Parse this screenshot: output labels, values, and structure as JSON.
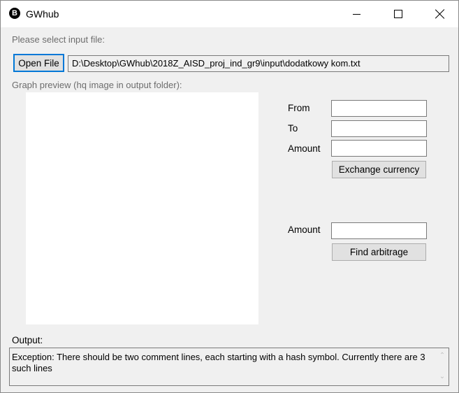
{
  "window": {
    "title": "GWhub",
    "app_icon_glyph": "B"
  },
  "input_section": {
    "prompt": "Please select input file:",
    "open_button_label": "Open File",
    "file_path": "D:\\Desktop\\GWhub\\2018Z_AISD_proj_ind_gr9\\input\\dodatkowy kom.txt"
  },
  "preview": {
    "label": "Graph preview (hq image in output folder):"
  },
  "exchange": {
    "from_label": "From",
    "to_label": "To",
    "amount_label": "Amount",
    "from_value": "",
    "to_value": "",
    "amount_value": "",
    "button_label": "Exchange currency"
  },
  "arbitrage": {
    "amount_label": "Amount",
    "amount_value": "",
    "button_label": "Find arbitrage"
  },
  "output": {
    "label": "Output:",
    "text": "Exception: There should be two comment lines, each starting with a hash symbol. Currently there are 3 such lines"
  },
  "colors": {
    "window_bg": "#f0f0f0",
    "titlebar_bg": "#ffffff",
    "button_bg": "#e1e1e1",
    "focus_border": "#0078d7"
  },
  "icons": {
    "app": "bitcoin-icon",
    "minimize": "minimize-icon",
    "maximize": "maximize-icon",
    "close": "close-icon",
    "scroll_up": "chevron-up-icon",
    "scroll_down": "chevron-down-icon"
  }
}
